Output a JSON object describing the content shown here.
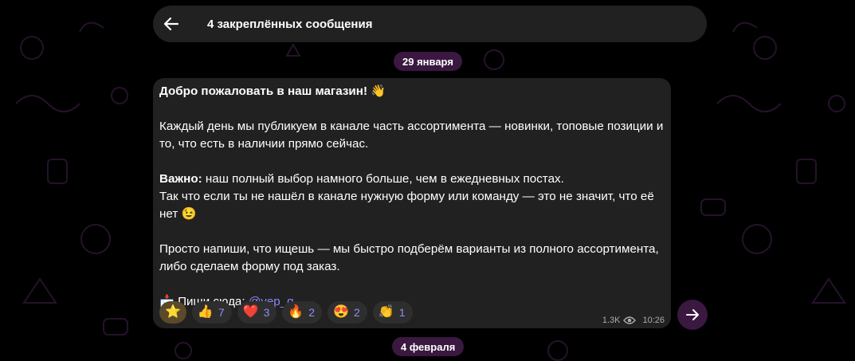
{
  "header": {
    "title": "4 закреплённых сообщения"
  },
  "dates": {
    "first": "29 января",
    "second": "4 февраля"
  },
  "message": {
    "greeting": "Добро пожаловать в наш магазин! 👋",
    "para1": "Каждый день мы публикуем в канале часть ассортимента — новинки, топовые позиции и то, что есть в наличии прямо сейчас.",
    "important_label": "Важно:",
    "important_text": " наш полный выбор намного больше, чем в ежедневных постах.",
    "para2b": "Так что если ты не нашёл в канале нужную форму или команду — это не значит, что её нет 😉",
    "para3": "Просто напиши, что ищешь — мы быстро подберём варианты из полного ассортимента, либо сделаем форму под заказ.",
    "contact_prefix": "📩 Пиши сюда: ",
    "contact_link": "@yep_q",
    "views": "1.3K",
    "time": "10:26"
  },
  "reactions": [
    {
      "emoji": "⭐",
      "count": "",
      "selected": true
    },
    {
      "emoji": "👍",
      "count": "7"
    },
    {
      "emoji": "❤️",
      "count": "3"
    },
    {
      "emoji": "🔥",
      "count": "2"
    },
    {
      "emoji": "😍",
      "count": "2"
    },
    {
      "emoji": "👏",
      "count": "1"
    }
  ],
  "icons": {
    "back": "arrow-left-icon",
    "forward": "arrow-right-icon",
    "views": "eye-icon"
  },
  "colors": {
    "accent": "#3a1840",
    "bubble": "#212121",
    "link": "#8a8aff"
  }
}
